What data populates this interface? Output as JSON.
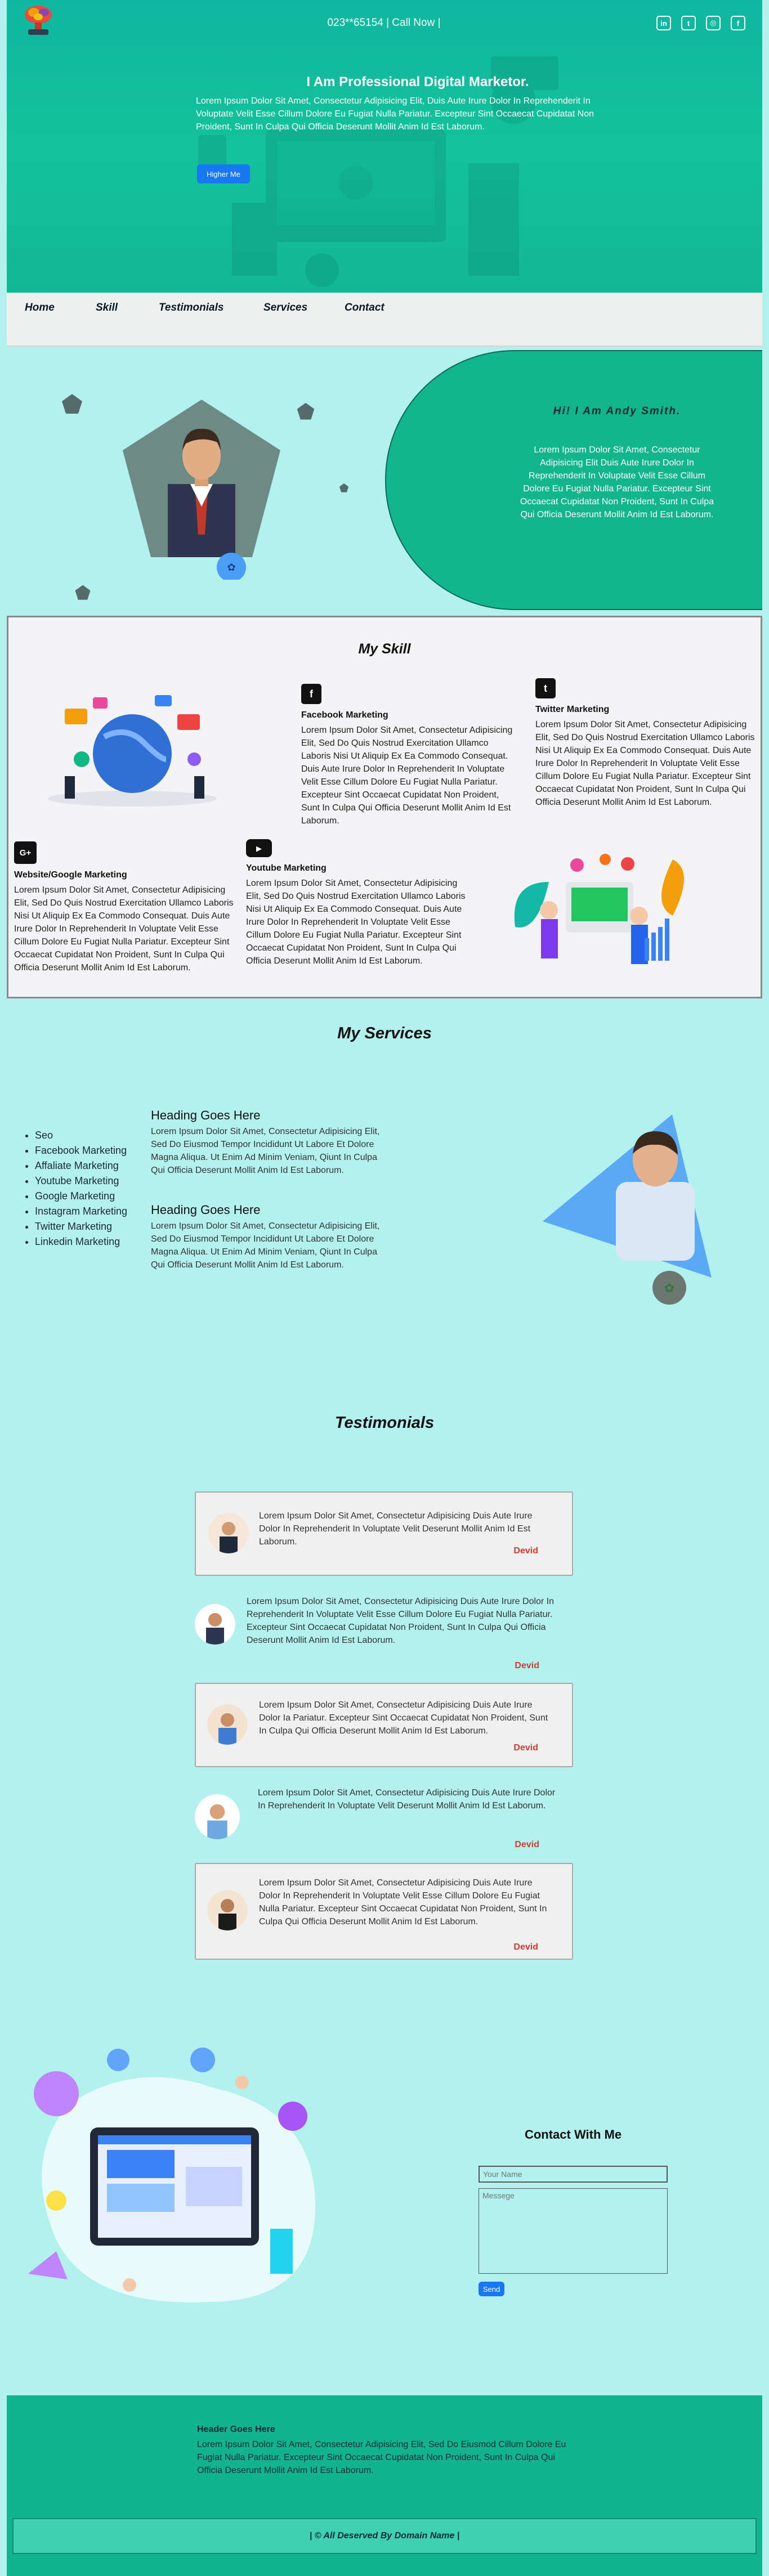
{
  "header": {
    "phone_text": "023**65154 | Call Now |",
    "social_icons": [
      "linkedin-icon",
      "twitter-icon",
      "instagram-icon",
      "facebook-icon"
    ]
  },
  "hero": {
    "title": "I Am Professional Digital Marketor.",
    "text": "Lorem Ipsum Dolor Sit Amet, Consectetur Adipisicing Elit, Duis Aute Irure Dolor In Reprehenderit In Voluptate Velit Esse Cillum Dolore Eu Fugiat Nulla Pariatur. Excepteur Sint Occaecat Cupidatat Non Proident, Sunt In Culpa Qui Officia Deserunt Mollit Anim Id Est Laborum.",
    "button": "Higher Me"
  },
  "nav": {
    "items": [
      "Home",
      "Skill",
      "Testimonials",
      "Services",
      "Contact"
    ]
  },
  "about": {
    "name": "Hi! I Am Andy Smith.",
    "text": "Lorem Ipsum Dolor Sit Amet, Consectetur Adipisicing Elit Duis Aute Irure Dolor In Reprehenderit In Voluptate Velit Esse Cillum Dolore Eu Fugiat Nulla Pariatur. Excepteur Sint Occaecat Cupidatat Non Proident, Sunt In Culpa Qui Officia Deserunt Mollit Anim Id Est Laborum."
  },
  "skill": {
    "title": "My Skill",
    "items": [
      {
        "icon": "facebook-icon",
        "title": "Facebook Marketing",
        "text": "Lorem Ipsum Dolor Sit Amet, Consectetur Adipisicing Elit, Sed Do Quis Nostrud Exercitation Ullamco Laboris Nisi Ut Aliquip Ex Ea Commodo Consequat. Duis Aute Irure Dolor In Reprehenderit In Voluptate Velit Esse Cillum Dolore Eu Fugiat Nulla Pariatur. Excepteur Sint Occaecat Cupidatat Non Proident, Sunt In Culpa Qui Officia Deserunt Mollit Anim Id Est Laborum."
      },
      {
        "icon": "twitter-icon",
        "title": "Twitter Marketing",
        "text": "Lorem Ipsum Dolor Sit Amet, Consectetur Adipisicing Elit, Sed Do Quis Nostrud Exercitation Ullamco Laboris Nisi Ut Aliquip Ex Ea Commodo Consequat. Duis Aute Irure Dolor In Reprehenderit In Voluptate Velit Esse Cillum Dolore Eu Fugiat Nulla Pariatur. Excepteur Sint Occaecat Cupidatat Non Proident, Sunt In Culpa Qui Officia Deserunt Mollit Anim Id Est Laborum."
      },
      {
        "icon": "google-plus-icon",
        "title": "Website/Google Marketing",
        "text": "Lorem Ipsum Dolor Sit Amet, Consectetur Adipisicing Elit, Sed Do Quis Nostrud Exercitation Ullamco Laboris Nisi Ut Aliquip Ex Ea Commodo Consequat. Duis Aute Irure Dolor In Reprehenderit In Voluptate Velit Esse Cillum Dolore Eu Fugiat Nulla Pariatur. Excepteur Sint Occaecat Cupidatat Non Proident, Sunt In Culpa Qui Officia Deserunt Mollit Anim Id Est Laborum."
      },
      {
        "icon": "youtube-icon",
        "title": "Youtube Marketing",
        "text": "Lorem Ipsum Dolor Sit Amet, Consectetur Adipisicing Elit, Sed Do Quis Nostrud Exercitation Ullamco Laboris Nisi Ut Aliquip Ex Ea Commodo Consequat. Duis Aute Irure Dolor In Reprehenderit In Voluptate Velit Esse Cillum Dolore Eu Fugiat Nulla Pariatur. Excepteur Sint Occaecat Cupidatat Non Proident, Sunt In Culpa Qui Officia Deserunt Mollit Anim Id Est Laborum."
      }
    ]
  },
  "services": {
    "title": "My Services",
    "list": [
      "Seo",
      "Facebook Marketing",
      "Affaliate Marketing",
      "Youtube Marketing",
      "Google Marketing",
      "Instagram Marketing",
      "Twitter Marketing",
      "Linkedin Marketing"
    ],
    "blocks": [
      {
        "heading": "Heading Goes Here",
        "text": "Lorem Ipsum Dolor Sit Amet, Consectetur Adipisicing Elit, Sed Do Eiusmod Tempor Incididunt Ut Labore Et Dolore Magna Aliqua. Ut Enim Ad Minim Veniam, Qiunt In Culpa Qui Officia Deserunt Mollit Anim Id Est Laborum."
      },
      {
        "heading": "Heading Goes Here",
        "text": "Lorem Ipsum Dolor Sit Amet, Consectetur Adipisicing Elit, Sed Do Eiusmod Tempor Incididunt Ut Labore Et Dolore Magna Aliqua. Ut Enim Ad Minim Veniam, Qiunt In Culpa Qui Officia Deserunt Mollit Anim Id Est Laborum."
      }
    ]
  },
  "testimonials": {
    "title": "Testimonials",
    "items": [
      {
        "text": "Lorem Ipsum Dolor Sit Amet, Consectetur Adipisicing Duis Aute Irure Dolor In Reprehenderit In Voluptate Velit Deserunt Mollit Anim Id Est Laborum.",
        "author": "Devid"
      },
      {
        "text": "Lorem Ipsum Dolor Sit Amet, Consectetur Adipisicing Duis Aute Irure Dolor In Reprehenderit In Voluptate Velit Esse Cillum Dolore Eu Fugiat Nulla Pariatur. Excepteur Sint Occaecat Cupidatat Non Proident, Sunt In Culpa Qui Officia Deserunt Mollit Anim Id Est Laborum.",
        "author": "Devid"
      },
      {
        "text": "Lorem Ipsum Dolor Sit Amet, Consectetur Adipisicing Duis Aute Irure Dolor Ia Pariatur. Excepteur Sint Occaecat Cupidatat Non Proident, Sunt In Culpa Qui Officia Deserunt Mollit Anim Id Est Laborum.",
        "author": "Devid"
      },
      {
        "text": "Lorem Ipsum Dolor Sit Amet, Consectetur Adipisicing Duis Aute Irure Dolor In Reprehenderit In Voluptate Velit Deserunt Mollit Anim Id Est Laborum.",
        "author": "Devid"
      },
      {
        "text": "Lorem Ipsum Dolor Sit Amet, Consectetur Adipisicing Duis Aute Irure Dolor In Reprehenderit In Voluptate Velit Esse Cillum Dolore Eu Fugiat Nulla Pariatur. Excepteur Sint Occaecat Cupidatat Non Proident, Sunt In Culpa Qui Officia Deserunt Mollit Anim Id Est Laborum.",
        "author": "Devid"
      }
    ]
  },
  "contact": {
    "title": "Contact With Me",
    "name_placeholder": "Your Name",
    "message_placeholder": "Messege",
    "send_label": "Send"
  },
  "footer": {
    "heading": "Header Goes Here",
    "text": "Lorem Ipsum Dolor Sit Amet, Consectetur Adipisicing Elit, Sed Do Eiusmod Cillum Dolore Eu Fugiat Nulla Pariatur. Excepteur Sint Occaecat Cupidatat Non Proident, Sunt In Culpa Qui Officia Deserunt Mollit Anim Id Est Laborum.",
    "copyright": "| © All Deserved By Domain Name |"
  },
  "colors": {
    "teal": "#12b58c",
    "bg": "#b2f1ee",
    "button": "#1877f2",
    "author": "#d63a2c"
  }
}
